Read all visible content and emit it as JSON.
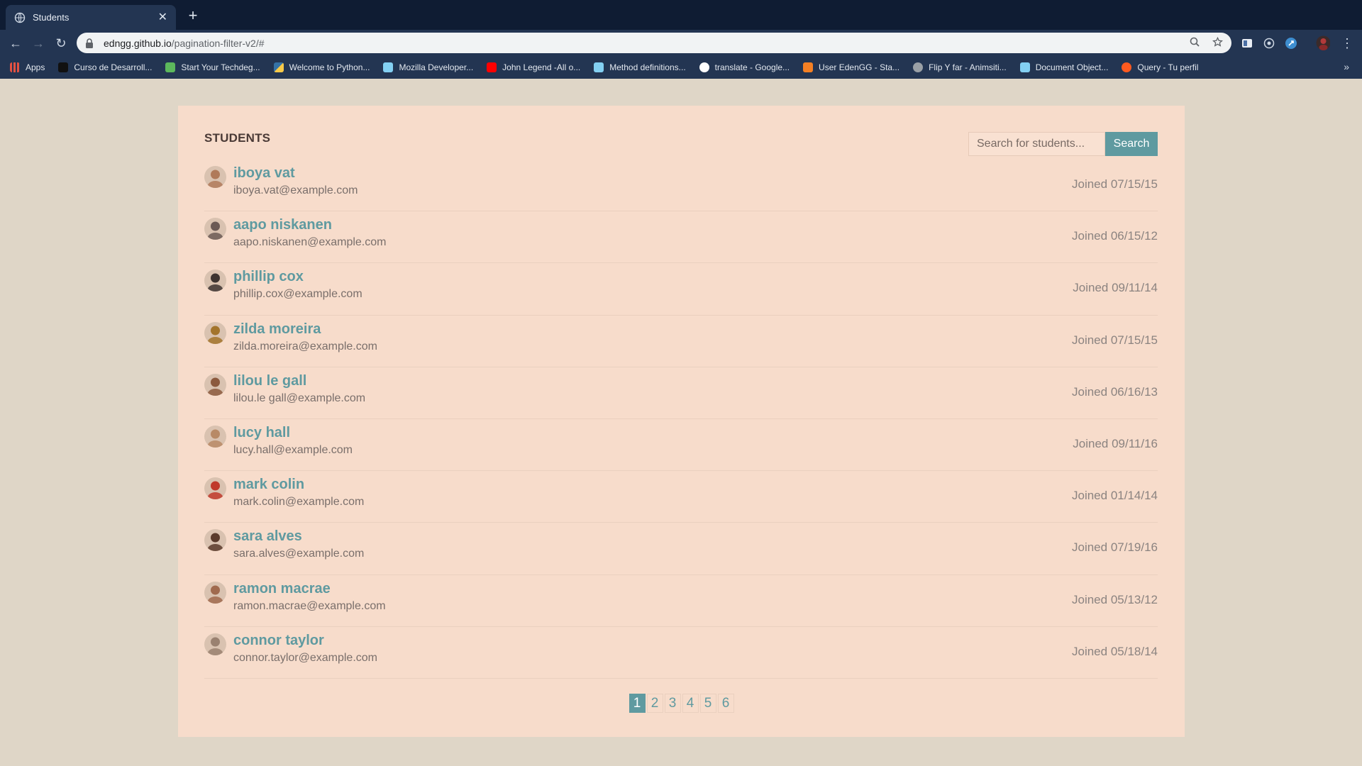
{
  "browser": {
    "tab_title": "Students",
    "new_tab_symbol": "+",
    "url_host": "edngg.github.io",
    "url_path": "/pagination-filter-v2/#",
    "bookmarks": [
      {
        "label": "Apps",
        "color": "#e25142"
      },
      {
        "label": "Curso de Desarroll...",
        "color": "#111111"
      },
      {
        "label": "Start Your Techdeg...",
        "color": "#5cb85c"
      },
      {
        "label": "Welcome to Python...",
        "color": "#f7c948"
      },
      {
        "label": "Mozilla Developer...",
        "color": "#83d0f2"
      },
      {
        "label": "John Legend -All o...",
        "color": "#ff0000"
      },
      {
        "label": "Method definitions...",
        "color": "#83d0f2"
      },
      {
        "label": "translate - Google...",
        "color": "#ffffff"
      },
      {
        "label": "User EdenGG - Sta...",
        "color": "#f48024"
      },
      {
        "label": "Flip Y far - Animsiti...",
        "color": "#9aa0a6"
      },
      {
        "label": "Document Object...",
        "color": "#83d0f2"
      },
      {
        "label": "Query - Tu perfil",
        "color": "#ff5a1f"
      }
    ]
  },
  "page": {
    "heading": "STUDENTS",
    "search_placeholder": "Search for students...",
    "search_button": "Search",
    "accent_color": "#5f9aa0",
    "students": [
      {
        "name": "iboya vat",
        "email": "iboya.vat@example.com",
        "joined": "Joined 07/15/15",
        "avatar_tone": "#b07a5a"
      },
      {
        "name": "aapo niskanen",
        "email": "aapo.niskanen@example.com",
        "joined": "Joined 06/15/12",
        "avatar_tone": "#6b5a55"
      },
      {
        "name": "phillip cox",
        "email": "phillip.cox@example.com",
        "joined": "Joined 09/11/14",
        "avatar_tone": "#3d3431"
      },
      {
        "name": "zilda moreira",
        "email": "zilda.moreira@example.com",
        "joined": "Joined 07/15/15",
        "avatar_tone": "#a3742c"
      },
      {
        "name": "lilou le gall",
        "email": "lilou.le gall@example.com",
        "joined": "Joined 06/16/13",
        "avatar_tone": "#8c5a3e"
      },
      {
        "name": "lucy hall",
        "email": "lucy.hall@example.com",
        "joined": "Joined 09/11/16",
        "avatar_tone": "#b88a66"
      },
      {
        "name": "mark colin",
        "email": "mark.colin@example.com",
        "joined": "Joined 01/14/14",
        "avatar_tone": "#c0392b"
      },
      {
        "name": "sara alves",
        "email": "sara.alves@example.com",
        "joined": "Joined 07/19/16",
        "avatar_tone": "#5a3b2c"
      },
      {
        "name": "ramon macrae",
        "email": "ramon.macrae@example.com",
        "joined": "Joined 05/13/12",
        "avatar_tone": "#a06a4e"
      },
      {
        "name": "connor taylor",
        "email": "connor.taylor@example.com",
        "joined": "Joined 05/18/14",
        "avatar_tone": "#9a8170"
      }
    ],
    "pages": [
      "1",
      "2",
      "3",
      "4",
      "5",
      "6"
    ],
    "active_page": "1"
  }
}
